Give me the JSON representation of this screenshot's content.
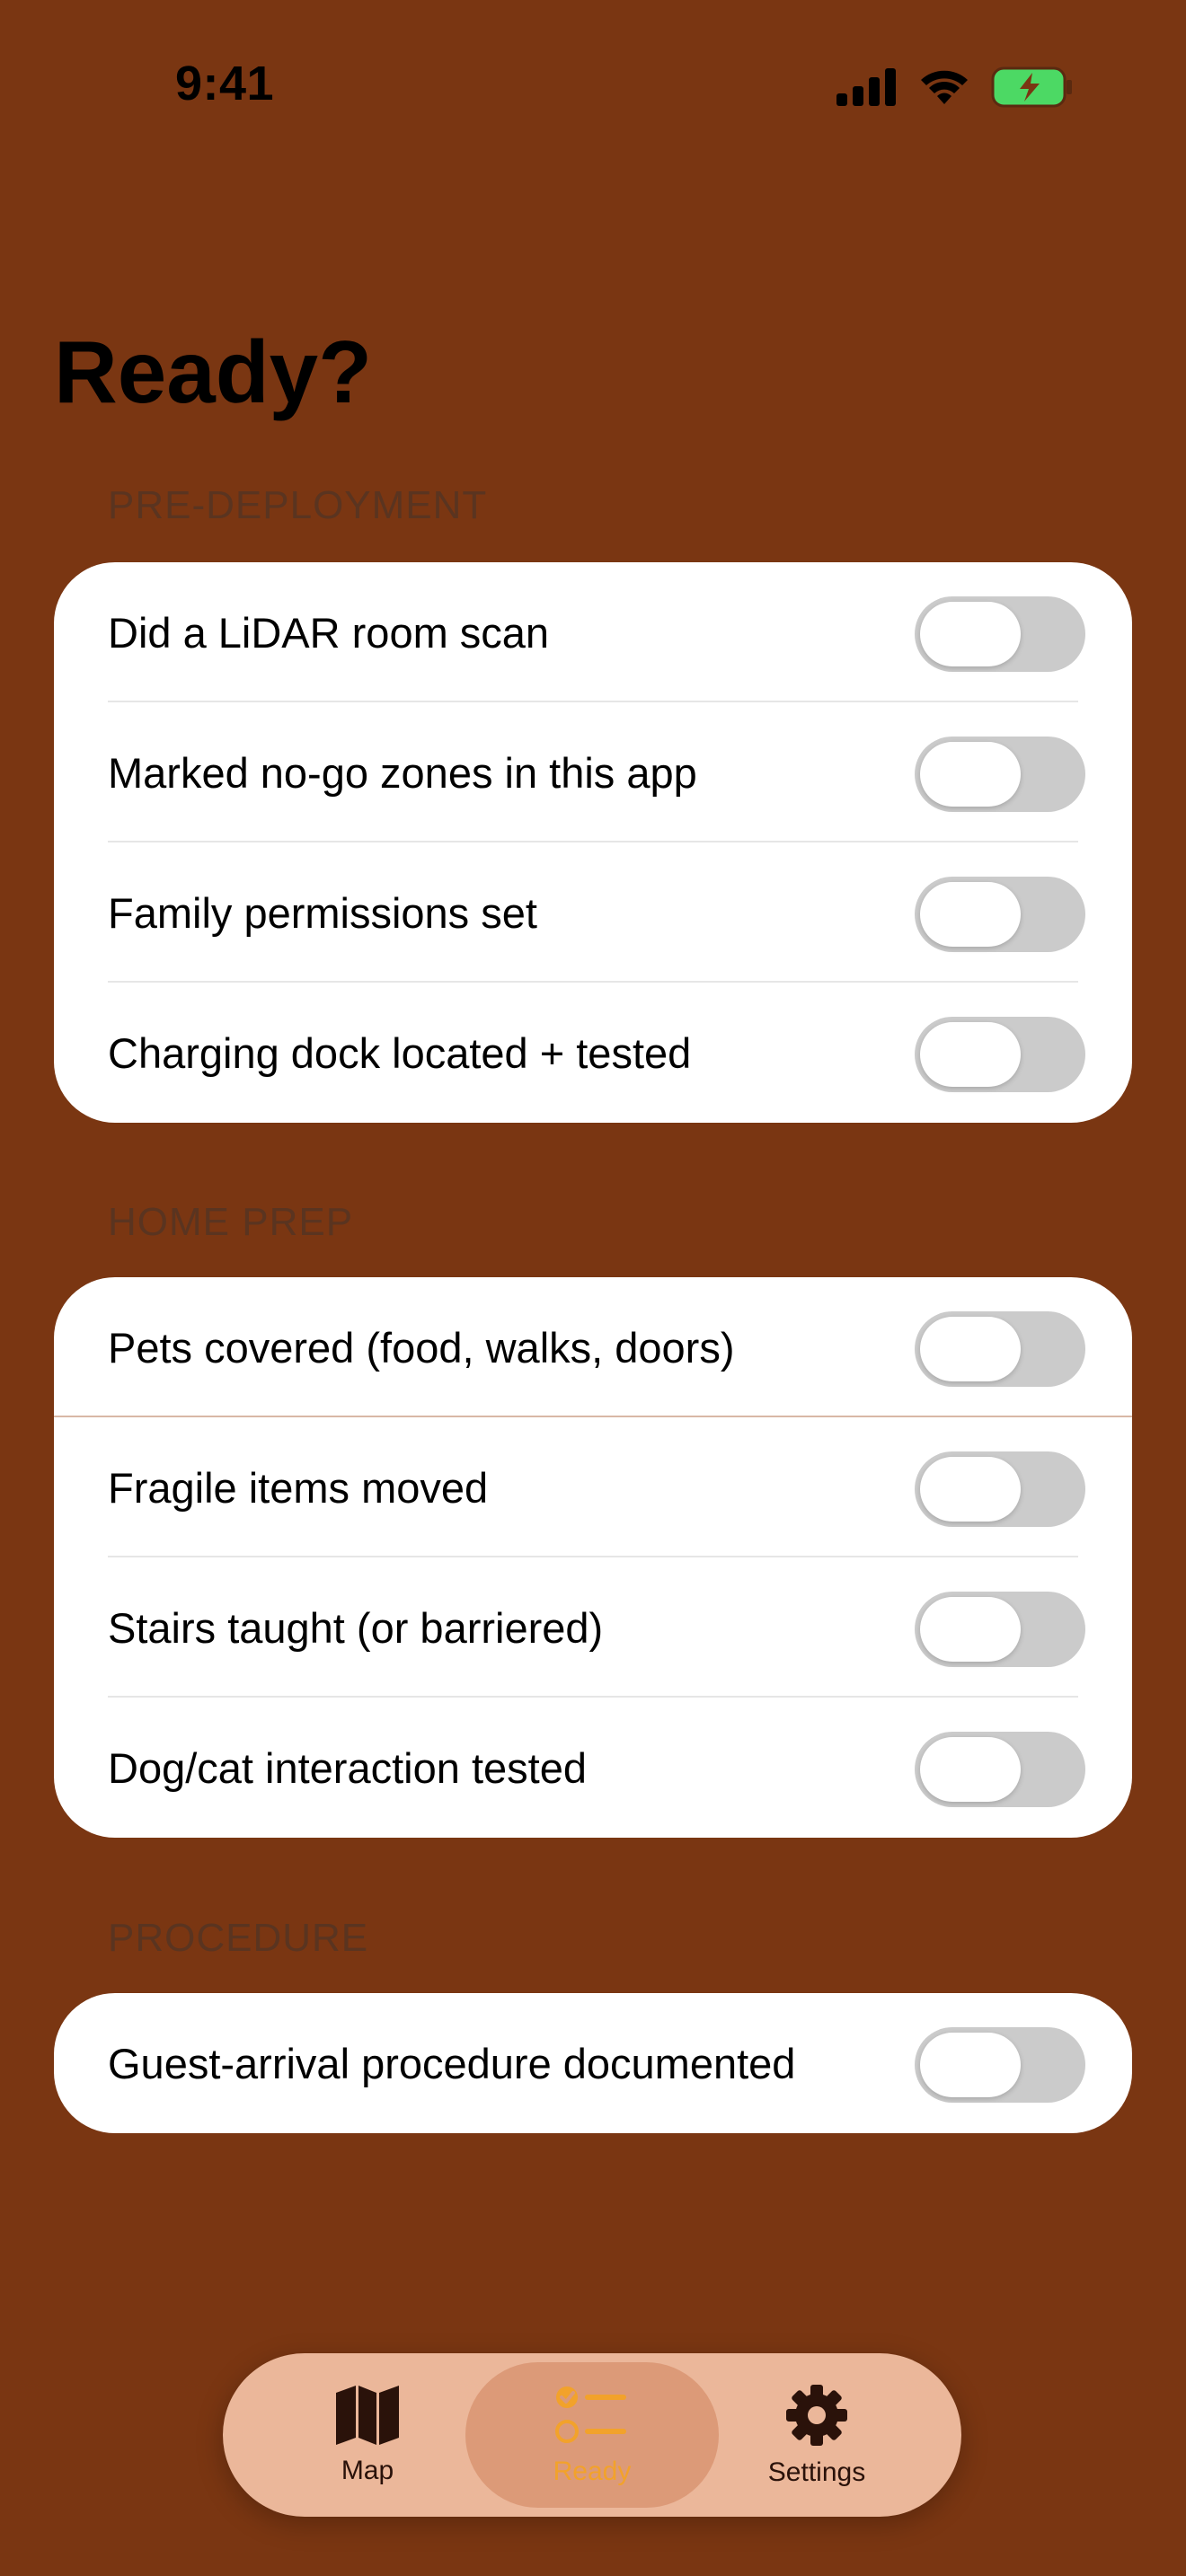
{
  "status": {
    "time": "9:41"
  },
  "page": {
    "title": "Ready?"
  },
  "sections": [
    {
      "header": "PRE-DEPLOYMENT",
      "items": [
        {
          "label": "Did a LiDAR room scan",
          "on": false
        },
        {
          "label": "Marked no-go zones in this app",
          "on": false
        },
        {
          "label": "Family permissions set",
          "on": false
        },
        {
          "label": "Charging dock located + tested",
          "on": false
        }
      ]
    },
    {
      "header": "HOME PREP",
      "items": [
        {
          "label": "Pets covered (food, walks, doors)",
          "on": false
        },
        {
          "label": "Fragile items moved",
          "on": false
        },
        {
          "label": "Stairs taught (or barriered)",
          "on": false
        },
        {
          "label": "Dog/cat interaction tested",
          "on": false
        }
      ]
    },
    {
      "header": "PROCEDURE",
      "items": [
        {
          "label": "Guest-arrival procedure documented",
          "on": false
        }
      ]
    }
  ],
  "tabs": [
    {
      "label": "Map",
      "icon": "map-icon",
      "active": false
    },
    {
      "label": "Ready",
      "icon": "checklist-icon",
      "active": true
    },
    {
      "label": "Settings",
      "icon": "gear-icon",
      "active": false
    }
  ],
  "colors": {
    "background": "#7a3612",
    "tab_bar": "#ebb79a",
    "accent": "#f2a22b",
    "toggle_off": "#cbcbcb",
    "battery": "#4cd964"
  }
}
